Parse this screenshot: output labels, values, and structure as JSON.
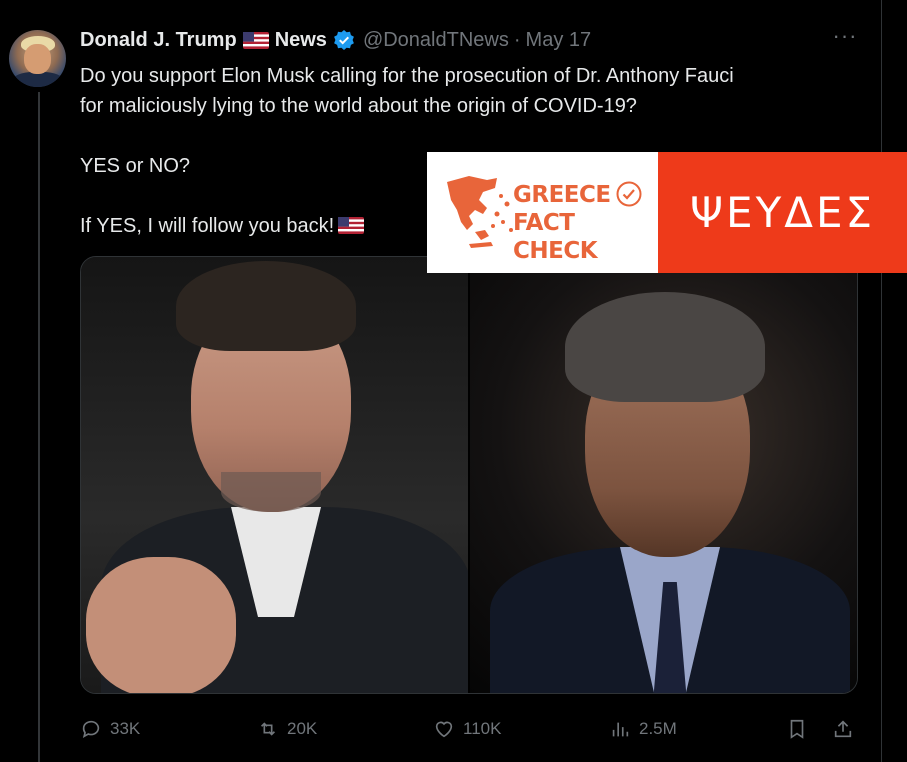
{
  "tweet": {
    "author_name": "Donald J. Trump",
    "author_suffix": "News",
    "handle": "@DonaldTNews",
    "separator": "·",
    "date": "May 17",
    "more_label": "···",
    "text_line1": "Do you support Elon Musk calling for the prosecution of Dr. Anthony Fauci",
    "text_line2": "for maliciously lying to the world about the origin of COVID-19?",
    "text_line3": "YES or NO?",
    "text_line4": "If YES, I will follow you back!"
  },
  "actions": {
    "replies": "33K",
    "retweets": "20K",
    "likes": "110K",
    "views": "2.5M"
  },
  "fact_check": {
    "brand_line1": "GREECE",
    "brand_line2": "FACT CHECK",
    "verdict": "ΨΕΥΔΕΣ",
    "brand_color": "#e8653a",
    "verdict_bg": "#ee3a1a"
  },
  "icons": {
    "flag": "us-flag-icon",
    "verified": "verified-badge-icon",
    "reply": "reply-icon",
    "retweet": "retweet-icon",
    "like": "heart-icon",
    "views": "views-bar-icon",
    "bookmark": "bookmark-icon",
    "share": "share-icon"
  }
}
